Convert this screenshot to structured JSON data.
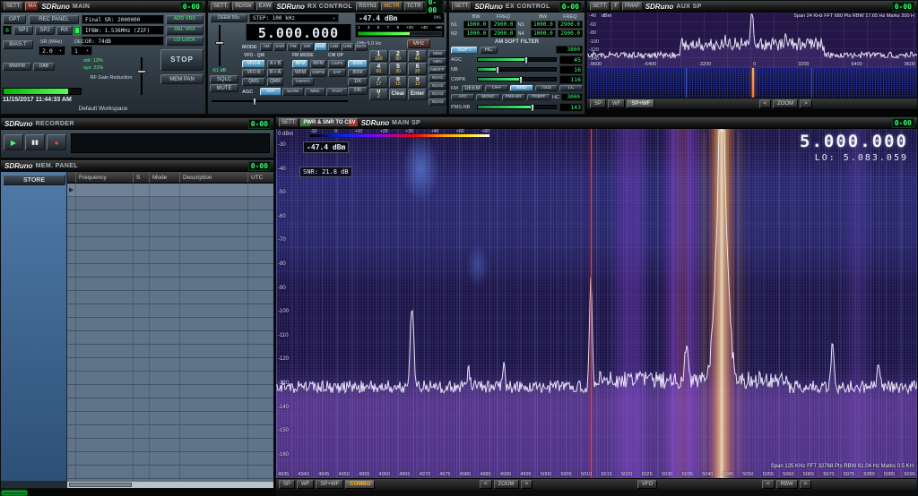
{
  "colors": {
    "accent_green": "#39ff6b",
    "combo_orange": "#ffb020",
    "vfo_red": "#ff3b30"
  },
  "main_panel": {
    "titlebar": {
      "sett": "SETT.",
      "ma": "MA",
      "logo": "SDRuno",
      "title": "MAIN",
      "led": "0-00"
    },
    "opt": "OPT",
    "rec_panel": "REC PANEL",
    "zero_led": "0",
    "sp1": "SP1",
    "sp2": "SP2",
    "rx": "RX",
    "final_sr": "Final SR: 2000000",
    "ifbw": "IFBW: 1.536MHz (ZIF)",
    "gr": "GR: 74dB",
    "sdr_load": "sdr: 13%",
    "sys_load": "sys: 21%",
    "bias_t": "BIAS-T",
    "sr_label": "SR (MHz)",
    "sr_value": "2.0",
    "dec_label": "DEC",
    "dec_value": "1",
    "mw_fm": "MW/FM",
    "dab": "DAB",
    "rf_gain_label": "RF Gain Reduction",
    "add_vrx": "ADD VRX",
    "del_vrx": "DEL VRX",
    "lo_lock": "LO LOCK",
    "stop": "STOP",
    "mem_pan": "MEM PAN",
    "datetime": "11/15/2017 11:44:33 AM",
    "workspace": "Default Workspace"
  },
  "rx_panel": {
    "titlebar": {
      "sett": "SETT.",
      "rdsw": "RDSW",
      "exw": "EXW",
      "logo": "SDRuno",
      "title": "RX CONTROL",
      "rsyn": "RSYN1",
      "mctr": "MCTR",
      "tctr": "TCTR",
      "led": "0-00"
    },
    "deem": "DEEM 50u",
    "step": "STEP: 100 kHz",
    "rms_value": "-47.4 dBm",
    "rms_label": "RMS",
    "smeter_ticks": [
      "1",
      "3",
      "5",
      "7",
      "9",
      "+20",
      "+40",
      "+60"
    ],
    "frequency": "5.000.000",
    "offs": "Offs 5.0 Hz",
    "vol_db": "-61 dB",
    "sqlc": "SQLC",
    "mute": "MUTE",
    "mode_label": "MODE",
    "modes": [
      "AM",
      "SAM",
      "FM",
      "CW",
      "DSB",
      "LSB",
      "USB",
      "DIGITAL"
    ],
    "active_mode": "DSB",
    "headers": {
      "vfo": "VFO - QM",
      "fm": "FM MODE",
      "cw": "CW OP"
    },
    "vfo_a": "VFO A",
    "a_to_b": "A > B",
    "vfo_b": "VFO B",
    "b_to_a": "B < A",
    "qms": "QMS",
    "qmr": "QMR",
    "nfm": "NFM",
    "mfm": "MFM",
    "wfm": "WFM",
    "swfm": "SWFM",
    "cwpk": "CWPK",
    "zap": "ZAP",
    "cwafc": "CWAFC",
    "filters": [
      "6000",
      "8000",
      "11K",
      "22K"
    ],
    "agc_label": "AGC",
    "agc_modes": [
      "OFF",
      "SLOW",
      "MED",
      "FAST"
    ],
    "nb_notch": [
      "NBW",
      "NBN",
      "NBOFF",
      "NCH1",
      "NCH2",
      "NCH3",
      "NCH4"
    ],
    "mhz": "MHz",
    "keypad": [
      {
        "digit": "1",
        "band": "160"
      },
      {
        "digit": "2",
        "band": "80"
      },
      {
        "digit": "3",
        "band": "40"
      },
      {
        "digit": "4",
        "band": "60"
      },
      {
        "digit": "5",
        "band": "30"
      },
      {
        "digit": "6",
        "band": "20"
      },
      {
        "digit": "7",
        "band": "17"
      },
      {
        "digit": "8",
        "band": "15"
      },
      {
        "digit": "9",
        "band": "12"
      },
      {
        "digit": "0",
        "band": "2"
      }
    ],
    "clear": "Clear",
    "enter": "Enter"
  },
  "ex_panel": {
    "titlebar": {
      "sett": "SETT.",
      "logo": "SDRuno",
      "title": "EX CONTROL",
      "led": "0-00"
    },
    "col_headers": [
      "BW",
      "FREQ",
      "BW",
      "FREQ"
    ],
    "notches": [
      {
        "id": "N1",
        "bw": "1000.0",
        "freq": "2900.0"
      },
      {
        "id": "N2",
        "bw": "1000.0",
        "freq": "2900.0"
      },
      {
        "id": "N3",
        "bw": "1000.0",
        "freq": "2900.0"
      },
      {
        "id": "N4",
        "bw": "1000.0",
        "freq": "2900.0"
      }
    ],
    "am_soft_header": "AM SOFT FILTER",
    "soft": "SOFT",
    "hc": "HC",
    "am_hc_value": "3800",
    "sliders": [
      {
        "label": "AGC",
        "value": "45",
        "fill": 62
      },
      {
        "label": "NB",
        "value": "16",
        "fill": 25
      },
      {
        "label": "CWPK",
        "value": "116",
        "fill": 55
      }
    ],
    "fm_label": "FM",
    "deem": "DEEM",
    "deem_options": [
      "OFF",
      "50uS",
      "75uS",
      "LC"
    ],
    "deem_active": "50uS",
    "row_buttons": [
      "AFC",
      "MONO",
      "PMS-NR",
      "PDBPF"
    ],
    "hc2_label": "HC",
    "hc2_value": "3000",
    "pms_label": "PMS-NB",
    "pms_value": "143",
    "pms_fill": 70
  },
  "aux_panel": {
    "titlebar": {
      "sett": "SETT.",
      "f": "F",
      "pmaf": "PMAF",
      "logo": "SDRuno",
      "title": "AUX SP",
      "led": "0-00"
    },
    "ylabel": "dBm",
    "info": "Span 24 KHz  FFT 680 Pts  RBW 17.65 Hz  Marks 200 H",
    "y_ticks": [
      "-40",
      "-60",
      "-80",
      "-100",
      "-120",
      "-140"
    ],
    "x_ticks": [
      "-9600",
      "-6400",
      "-3200",
      "0",
      "3200",
      "6400",
      "9600"
    ],
    "view_buttons": [
      "SP",
      "WF",
      "SP+WF"
    ],
    "active_view": "SP+WF",
    "zoom_minus": "<",
    "zoom_label": "ZOOM",
    "zoom_plus": ">"
  },
  "recorder_panel": {
    "titlebar": {
      "logo": "SDRuno",
      "title": "RECORDER",
      "led": "0-00"
    },
    "buttons": [
      {
        "name": "play",
        "glyph": "▶"
      },
      {
        "name": "pause",
        "glyph": "▮▮"
      },
      {
        "name": "record",
        "glyph": "●"
      }
    ]
  },
  "mem_panel": {
    "titlebar": {
      "logo": "SDRuno",
      "title": "MEM. PANEL",
      "led": "0-00"
    },
    "store": "STORE",
    "columns": [
      "Frequency",
      "S",
      "Mode",
      "Description",
      "UTC"
    ],
    "row_count": 23
  },
  "mainsp_panel": {
    "titlebar": {
      "sett": "SETT.",
      "csv": "PWR & SNR TO CSV",
      "logo": "SDRuno",
      "title": "MAIN SP",
      "led": "0-00"
    },
    "frequency": "5.000.000",
    "lo": "LO: 5.083.059",
    "power": "-47.4 dBm",
    "snr": "SNR: 21.8 dB",
    "legend_ticks": [
      "-10",
      "0",
      "+10",
      "+20",
      "+30",
      "+40",
      "+50",
      "+60"
    ],
    "y_ticks": [
      "0 dBm",
      "-30",
      "-40",
      "-50",
      "-60",
      "-70",
      "-80",
      "-90",
      "-100",
      "-110",
      "-120",
      "-130",
      "-140",
      "-150",
      "-160"
    ],
    "x_ticks": [
      "4935",
      "4940",
      "4945",
      "4950",
      "4955",
      "4960",
      "4965",
      "4970",
      "4975",
      "4980",
      "4985",
      "4990",
      "4995",
      "5000",
      "5005",
      "5010",
      "5015",
      "5020",
      "5025",
      "5030",
      "5035",
      "5040",
      "5045",
      "5050",
      "5055",
      "5060",
      "5065",
      "5070",
      "5075",
      "5080",
      "5085",
      "5090"
    ],
    "info": "Span 125 KHz  FFT 32768 Pts  RBW 61.04 Hz  Marks 0.5 KH",
    "view_buttons": [
      "SP",
      "WF",
      "SP+WF",
      "COMBO"
    ],
    "active_view": "COMBO",
    "zoom_minus": "<",
    "zoom_label": "ZOOM",
    "zoom_plus": ">",
    "vfo": "VFO",
    "rbw_minus": "<",
    "rbw_label": "RBW",
    "rbw_plus": ">"
  }
}
